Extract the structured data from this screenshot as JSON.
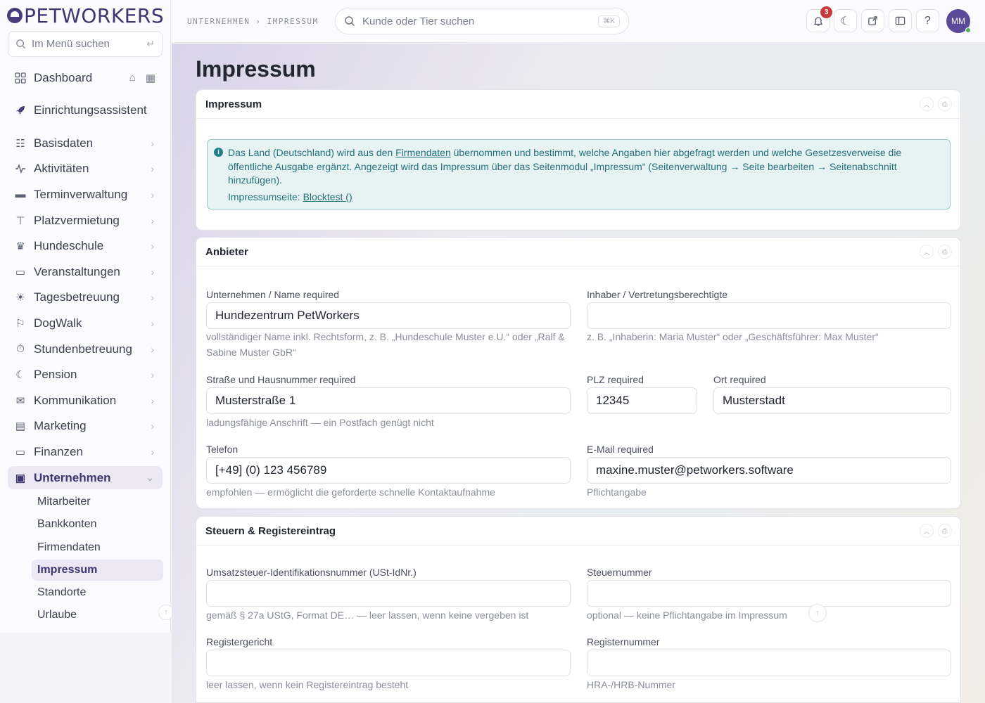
{
  "brand": {
    "name": "PETWORKERS"
  },
  "sidebar": {
    "search_placeholder": "Im Menü suchen",
    "search_enter": "↵",
    "items": [
      {
        "label": "Dashboard"
      },
      {
        "label": "Einrichtungsassistent"
      },
      {
        "label": "Basisdaten"
      },
      {
        "label": "Aktivitäten"
      },
      {
        "label": "Terminverwaltung"
      },
      {
        "label": "Platzvermietung"
      },
      {
        "label": "Hundeschule"
      },
      {
        "label": "Veranstaltungen"
      },
      {
        "label": "Tagesbetreuung"
      },
      {
        "label": "DogWalk"
      },
      {
        "label": "Stundenbetreuung"
      },
      {
        "label": "Pension"
      },
      {
        "label": "Kommunikation"
      },
      {
        "label": "Marketing"
      },
      {
        "label": "Finanzen"
      },
      {
        "label": "Unternehmen"
      }
    ],
    "sub_items": [
      {
        "label": "Mitarbeiter"
      },
      {
        "label": "Bankkonten"
      },
      {
        "label": "Firmendaten"
      },
      {
        "label": "Impressum"
      },
      {
        "label": "Standorte"
      },
      {
        "label": "Urlaube"
      }
    ]
  },
  "topbar": {
    "breadcrumb": [
      "UNTERNEHMEN",
      "›",
      "IMPRESSUM"
    ],
    "search_placeholder": "Kunde oder Tier suchen",
    "search_shortcut": "⌘K",
    "notification_count": "3",
    "help_label": "?",
    "avatar_initials": "MM"
  },
  "page": {
    "title": "Impressum",
    "impressum_card": {
      "title": "Impressum",
      "info_part1": "Das Land (Deutschland) wird aus den ",
      "info_link": "Firmendaten",
      "info_part2": " übernommen und bestimmt, welche Angaben hier abgefragt werden und welche Gesetzesverweise die öffentliche Ausgabe ergänzt. Angezeigt wird das Impressum über das Seitenmodul „Impressum“ (Seitenverwaltung → Seite bearbeiten → Seitenabschnitt hinzufügen).",
      "page_label": "Impressumseite: ",
      "page_link": "Blocktest ()"
    },
    "anbieter_card": {
      "title": "Anbieter",
      "company_label": "Unternehmen / Name required",
      "company_value": "Hundezentrum PetWorkers",
      "company_hint": "vollständiger Name inkl. Rechtsform, z. B. „Hundeschule Muster e.U.“ oder „Ralf & Sabine Muster GbR“",
      "owner_label": "Inhaber / Vertretungsberechtigte",
      "owner_value": "",
      "owner_hint": "z. B. „Inhaberin: Maria Muster“ oder „Geschäftsführer: Max Muster“",
      "street_label": "Straße und Hausnummer required",
      "street_value": "Musterstraße 1",
      "street_hint": "ladungsfähige Anschrift — ein Postfach genügt nicht",
      "zip_label": "PLZ required",
      "zip_value": "12345",
      "city_label": "Ort required",
      "city_value": "Musterstadt",
      "phone_label": "Telefon",
      "phone_value": "[+49] (0) 123 456789",
      "phone_hint": "empfohlen — ermöglicht die geforderte schnelle Kontaktaufnahme",
      "email_label": "E-Mail required",
      "email_value": "maxine.muster@petworkers.software",
      "email_hint": "Pflichtangabe"
    },
    "tax_card": {
      "title": "Steuern & Registereintrag",
      "vat_label": "Umsatzsteuer-Identifikationsnummer (USt-IdNr.)",
      "vat_value": "",
      "vat_hint": "gemäß § 27a UStG, Format DE… — leer lassen, wenn keine vergeben ist",
      "taxno_label": "Steuernummer",
      "taxno_value": "",
      "taxno_hint": "optional — keine Pflichtangabe im Impressum",
      "court_label": "Registergericht",
      "court_value": "",
      "court_hint": "leer lassen, wenn kein Registereintrag besteht",
      "regno_label": "Registernummer",
      "regno_value": "",
      "regno_hint": "HRA-/HRB-Nummer"
    }
  }
}
